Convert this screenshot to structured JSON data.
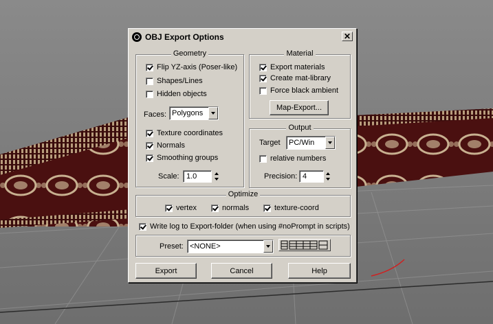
{
  "dialog": {
    "title": "OBJ Export Options",
    "close_label": "✕"
  },
  "geometry": {
    "label": "Geometry",
    "flip_yz": {
      "label": "Flip YZ-axis (Poser-like)",
      "checked": true
    },
    "shapes_lines": {
      "label": "Shapes/Lines",
      "checked": false
    },
    "hidden_objects": {
      "label": "Hidden objects",
      "checked": false
    },
    "faces_label": "Faces:",
    "faces_value": "Polygons",
    "texture_coords": {
      "label": "Texture coordinates",
      "checked": true
    },
    "normals": {
      "label": "Normals",
      "checked": true
    },
    "smoothing_groups": {
      "label": "Smoothing groups",
      "checked": true
    },
    "scale_label": "Scale:",
    "scale_value": "1.0"
  },
  "material": {
    "label": "Material",
    "export_materials": {
      "label": "Export materials",
      "checked": true
    },
    "create_mat_library": {
      "label": "Create mat-library",
      "checked": true
    },
    "force_black_ambient": {
      "label": "Force black ambient",
      "checked": false
    },
    "map_export_label": "Map-Export..."
  },
  "output": {
    "label": "Output",
    "target_label": "Target",
    "target_value": "PC/Win",
    "relative_numbers": {
      "label": "relative numbers",
      "checked": false
    },
    "precision_label": "Precision:",
    "precision_value": "4"
  },
  "optimize": {
    "label": "Optimize",
    "vertex": {
      "label": "vertex",
      "checked": true
    },
    "normals": {
      "label": "normals",
      "checked": true
    },
    "texture_coord": {
      "label": "texture-coord",
      "checked": true
    }
  },
  "write_log": {
    "label": "Write log to Export-folder (when using #noPrompt in scripts)",
    "checked": true
  },
  "preset": {
    "label": "Preset:",
    "value": "<NONE>"
  },
  "buttons": {
    "export": "Export",
    "cancel": "Cancel",
    "help": "Help"
  },
  "colors": {
    "dialog_bg": "#d4d0c8",
    "viewport_bg": "#7a7a7a",
    "ribbon_maroon": "#4a1010",
    "ribbon_pattern": "#c8b090"
  }
}
